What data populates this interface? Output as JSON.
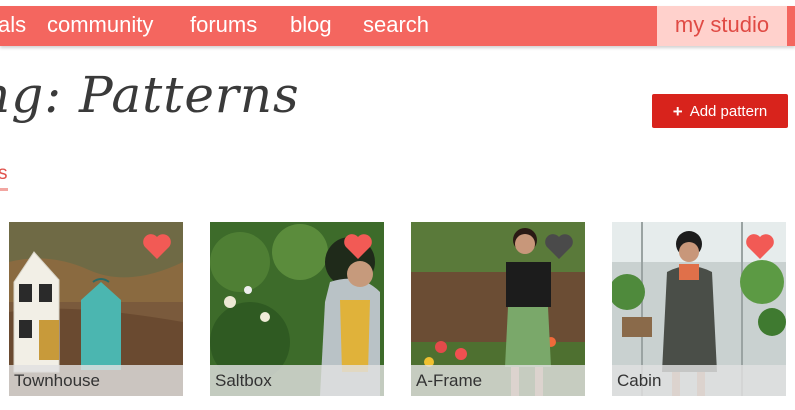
{
  "nav": {
    "items": [
      {
        "label": "als"
      },
      {
        "label": "community"
      },
      {
        "label": "forums"
      },
      {
        "label": "blog"
      },
      {
        "label": "search"
      }
    ],
    "studio_label": "my studio"
  },
  "page": {
    "title": "ng: Patterns",
    "add_button_label": "Add pattern",
    "active_tab_label": "s"
  },
  "colors": {
    "nav_bg": "#f4665f",
    "studio_bg": "#ffd1cc",
    "button_red": "#d8231c",
    "heart_active": "#f25a55",
    "heart_inactive": "#4a4a4a"
  },
  "patterns": [
    {
      "name": "Townhouse",
      "favorited": true
    },
    {
      "name": "Saltbox",
      "favorited": true
    },
    {
      "name": "A-Frame",
      "favorited": false
    },
    {
      "name": "Cabin",
      "favorited": true
    }
  ]
}
